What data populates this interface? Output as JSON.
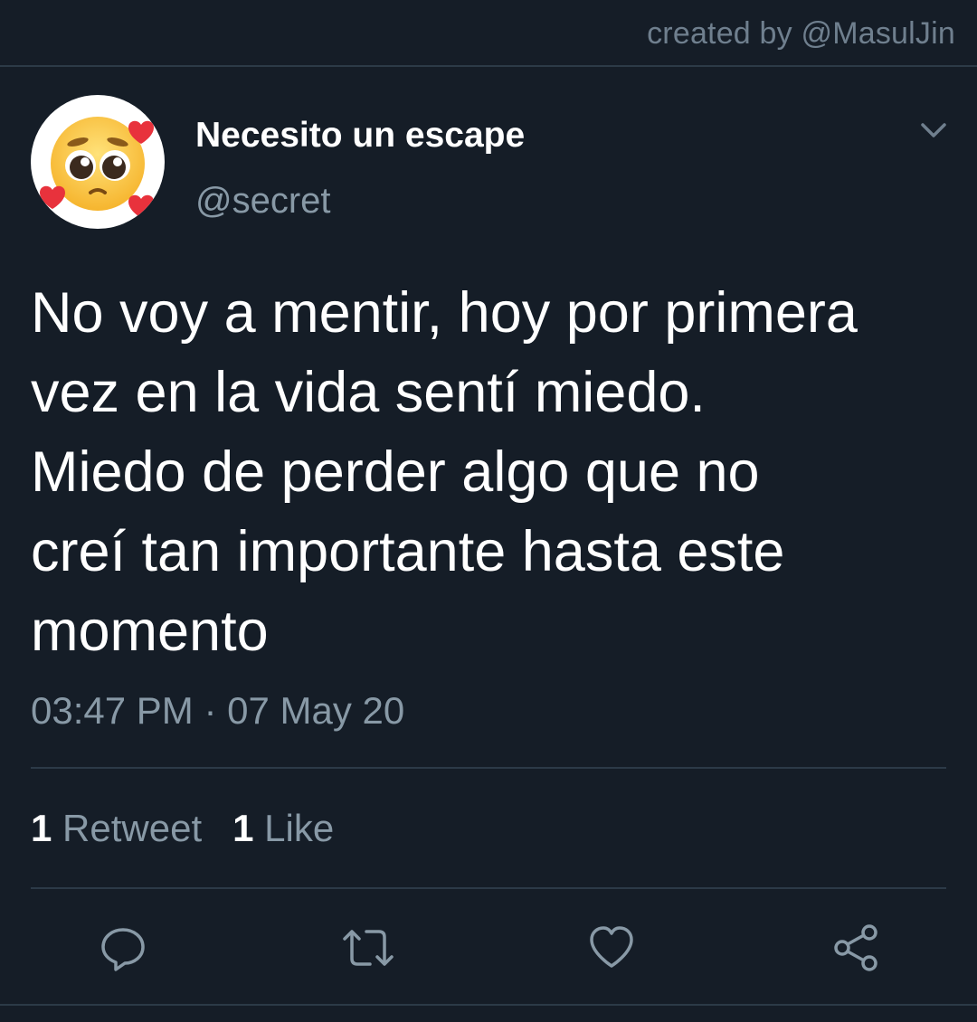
{
  "credit": "created by @MasulJin",
  "author": {
    "display_name": "Necesito un escape",
    "handle": "@secret",
    "avatar_icon": "pleading-face-with-hearts-icon"
  },
  "tweet": {
    "text": "No voy a mentir, hoy por primera\nvez en la vida sentí miedo.\nMiedo de perder algo que no\ncreí tan importante hasta este\nmomento",
    "timestamp": "03:47 PM · 07 May 20"
  },
  "stats": {
    "retweets_count": "1",
    "retweets_label": "Retweet",
    "likes_count": "1",
    "likes_label": "Like"
  },
  "actions": [
    "reply-icon",
    "retweet-icon",
    "like-icon",
    "share-icon"
  ],
  "colors": {
    "background": "#151d27",
    "secondary_text": "#8899a6",
    "divider": "#2c3a47",
    "primary_text": "#ffffff"
  }
}
